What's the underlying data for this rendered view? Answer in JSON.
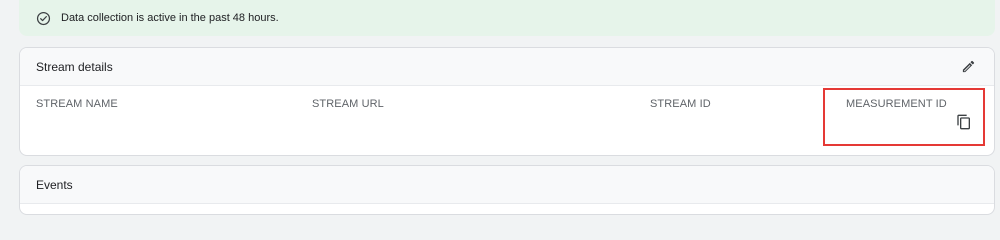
{
  "banner": {
    "icon": "check-circle-icon",
    "text": "Data collection is active in the past 48 hours.",
    "background": "#e6f4ea"
  },
  "stream_details": {
    "title": "Stream details",
    "edit_icon": "pencil-icon",
    "columns": {
      "stream_name": "STREAM NAME",
      "stream_url": "STREAM URL",
      "stream_id": "STREAM ID",
      "measurement_id": "MEASUREMENT ID"
    },
    "copy_icon": "copy-icon",
    "highlight_color": "#e53935"
  },
  "events": {
    "title": "Events"
  }
}
